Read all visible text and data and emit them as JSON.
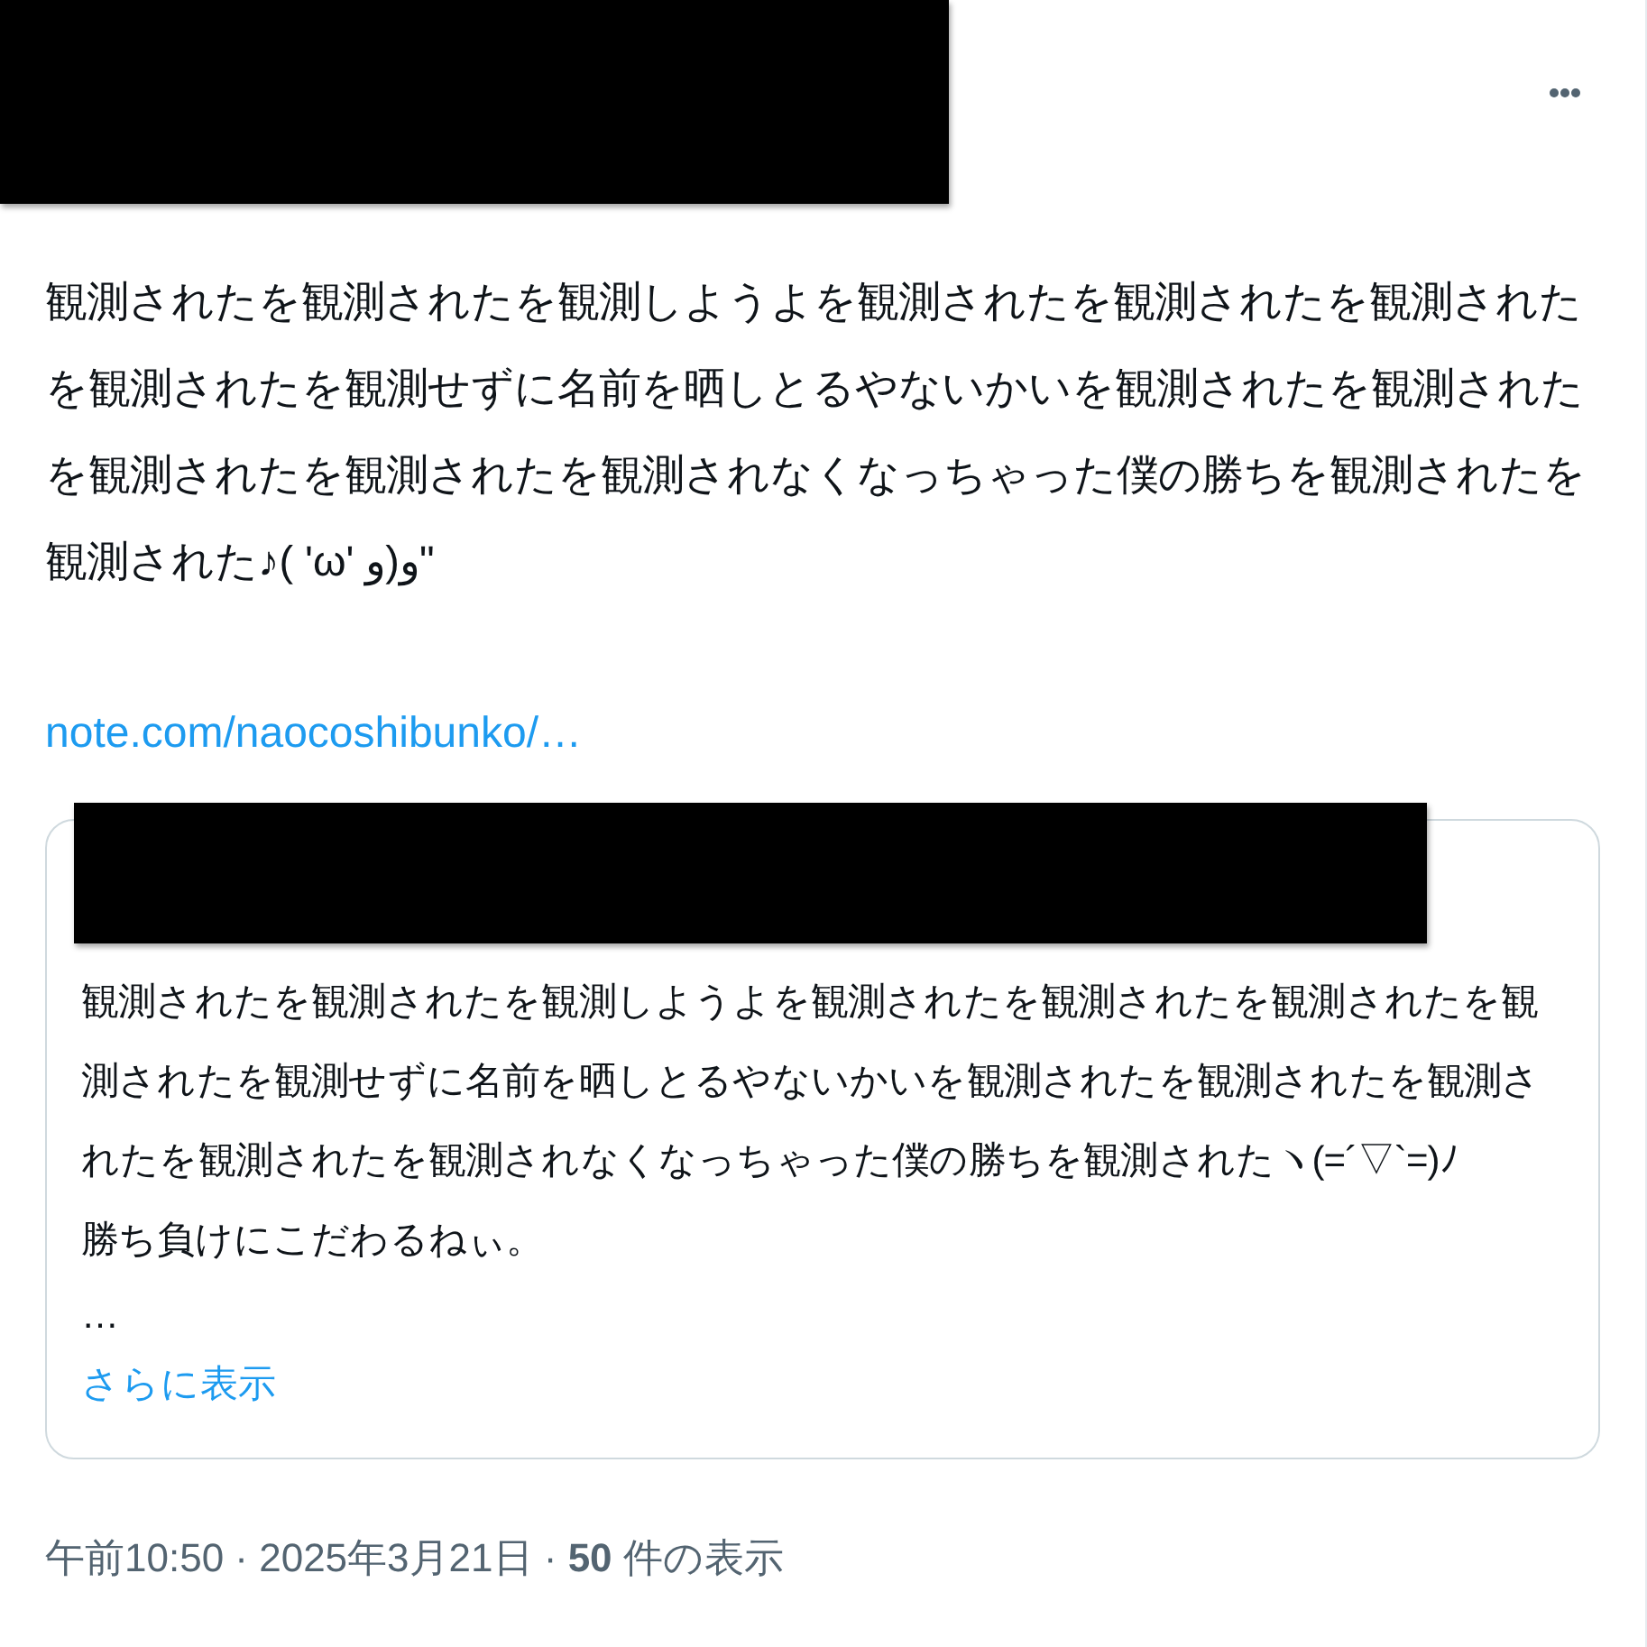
{
  "header": {
    "author_redacted": true
  },
  "post": {
    "text": "観測されたを観測されたを観測しようよを観測されたを観測されたを観測されたを観測されたを観測せずに名前を晒しとるやないかいを観測されたを観測されたを観測されたを観測されたを観測されなくなっちゃった僕の勝ちを観測されたを観測された♪( 'ω' و)و\"",
    "link": "note.com/naocoshibunko/…"
  },
  "quote": {
    "author_redacted": true,
    "paragraphs": [
      "観測されたを観測されたを観測しようよを観測されたを観測されたを観測されたを観測されたを観測せずに名前を晒しとるやないかいを観測されたを観測されたを観測されたを観測されたを観測されなくなっちゃった僕の勝ちを観測されたヽ(=´▽`=)ﾉ",
      "勝ち負けにこだわるねぃ。"
    ],
    "ellipsis": "…",
    "show_more": "さらに表示"
  },
  "meta": "午前10:50 · 2025年3月21日 · **50** 件の表示"
}
